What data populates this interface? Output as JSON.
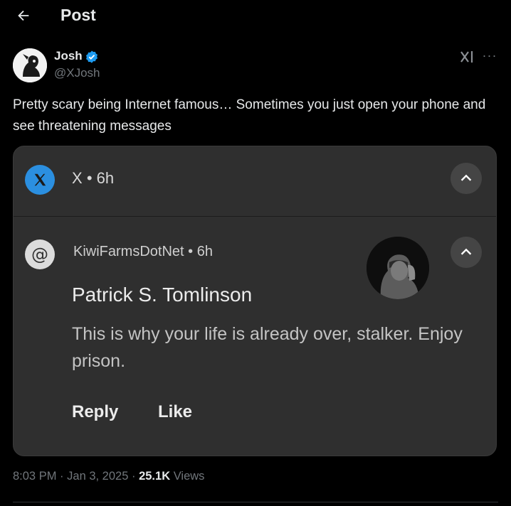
{
  "header": {
    "title": "Post"
  },
  "author": {
    "name": "Josh",
    "handle": "@XJosh"
  },
  "post": {
    "text": "Pretty scary being Internet famous… Sometimes you just open your phone and see threatening messages"
  },
  "notification": {
    "top_app": "X",
    "top_time": "6h",
    "source_app": "KiwiFarmsDotNet",
    "source_time": "6h",
    "title": "Patrick S. Tomlinson",
    "body": "This is why your life is already over, stalker. Enjoy prison.",
    "actions": {
      "reply": "Reply",
      "like": "Like"
    }
  },
  "meta": {
    "time": "8:03 PM",
    "date": "Jan 3, 2025",
    "views_count": "25.1K",
    "views_label": "Views"
  },
  "colors": {
    "background": "#000000",
    "verified": "#1d9bf0",
    "x_app_icon": "#2b8fe0",
    "notification_bg": "#2f2f2f"
  }
}
